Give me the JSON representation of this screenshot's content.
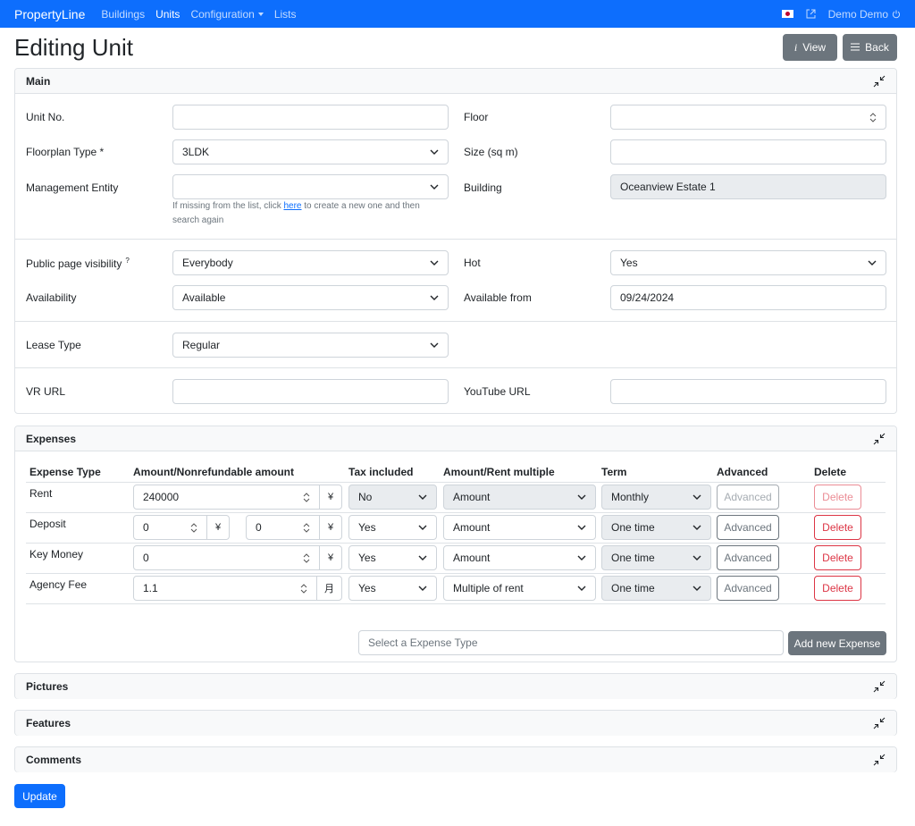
{
  "navbar": {
    "brand": "PropertyLine",
    "links": [
      "Buildings",
      "Units",
      "Configuration",
      "Lists"
    ],
    "user": "Demo Demo"
  },
  "page": {
    "title": "Editing Unit",
    "view_label": "View",
    "back_label": "Back",
    "update_label": "Update"
  },
  "main": {
    "header": "Main",
    "unit_no_label": "Unit No.",
    "unit_no_value": "",
    "floor_label": "Floor",
    "floor_value": "",
    "floorplan_label": "Floorplan Type *",
    "floorplan_value": "3LDK",
    "size_label": "Size (sq m)",
    "size_value": "",
    "mgmt_label": "Management Entity",
    "mgmt_value": "",
    "mgmt_help_pre": "If missing from the list, click ",
    "mgmt_help_link": "here",
    "mgmt_help_post": " to create a new one and then search again",
    "building_label": "Building",
    "building_value": "Oceanview Estate 1",
    "visibility_label": "Public page visibility",
    "visibility_help": "?",
    "visibility_value": "Everybody",
    "hot_label": "Hot",
    "hot_value": "Yes",
    "availability_label": "Availability",
    "availability_value": "Available",
    "available_from_label": "Available from",
    "available_from_value": "09/24/2024",
    "lease_label": "Lease Type",
    "lease_value": "Regular",
    "vr_label": "VR URL",
    "vr_value": "",
    "youtube_label": "YouTube URL",
    "youtube_value": ""
  },
  "expenses": {
    "header": "Expenses",
    "columns": [
      "Expense Type",
      "Amount/Nonrefundable amount",
      "Tax included",
      "Amount/Rent multiple",
      "Term",
      "Advanced",
      "Delete"
    ],
    "rows": [
      {
        "type": "Rent",
        "amount": "240000",
        "unit": "¥",
        "tax": "No",
        "mode": "Amount",
        "term": "Monthly",
        "advanced": "Advanced",
        "delete": "Delete"
      },
      {
        "type": "Deposit",
        "amount": "0",
        "unit": "¥",
        "nonref": "0",
        "nonref_unit": "¥",
        "tax": "Yes",
        "mode": "Amount",
        "term": "One time",
        "advanced": "Advanced",
        "delete": "Delete"
      },
      {
        "type": "Key Money",
        "amount": "0",
        "unit": "¥",
        "tax": "Yes",
        "mode": "Amount",
        "term": "One time",
        "advanced": "Advanced",
        "delete": "Delete"
      },
      {
        "type": "Agency Fee",
        "amount": "1.1",
        "unit": "月",
        "tax": "Yes",
        "mode": "Multiple of rent",
        "term": "One time",
        "advanced": "Advanced",
        "delete": "Delete"
      }
    ],
    "select_placeholder": "Select a Expense Type",
    "add_label": "Add new Expense"
  },
  "sections": {
    "pictures": "Pictures",
    "features": "Features",
    "comments": "Comments"
  },
  "colors": {
    "primary": "#0d6efd",
    "secondary": "#6c757d",
    "danger": "#dc3545"
  }
}
